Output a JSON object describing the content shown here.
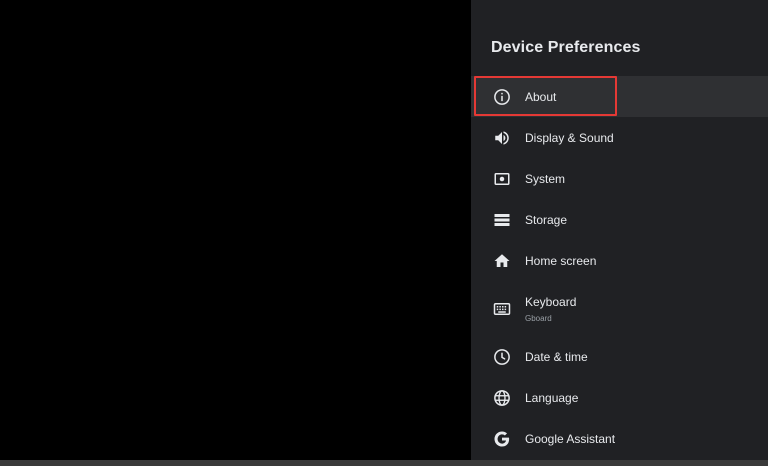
{
  "panel": {
    "title": "Device Preferences"
  },
  "menu": {
    "items": [
      {
        "label": "About",
        "sublabel": "",
        "icon": "info-icon"
      },
      {
        "label": "Display & Sound",
        "sublabel": "",
        "icon": "volume-icon"
      },
      {
        "label": "System",
        "sublabel": "",
        "icon": "system-icon"
      },
      {
        "label": "Storage",
        "sublabel": "",
        "icon": "storage-icon"
      },
      {
        "label": "Home screen",
        "sublabel": "",
        "icon": "home-icon"
      },
      {
        "label": "Keyboard",
        "sublabel": "Gboard",
        "icon": "keyboard-icon"
      },
      {
        "label": "Date & time",
        "sublabel": "",
        "icon": "clock-icon"
      },
      {
        "label": "Language",
        "sublabel": "",
        "icon": "globe-icon"
      },
      {
        "label": "Google Assistant",
        "sublabel": "",
        "icon": "google-icon"
      }
    ]
  },
  "colors": {
    "panel_background": "#202124",
    "focused_background": "#2f3033",
    "highlight_border": "#e53935",
    "text": "#e8eaed",
    "subtext": "#9aa0a6"
  }
}
